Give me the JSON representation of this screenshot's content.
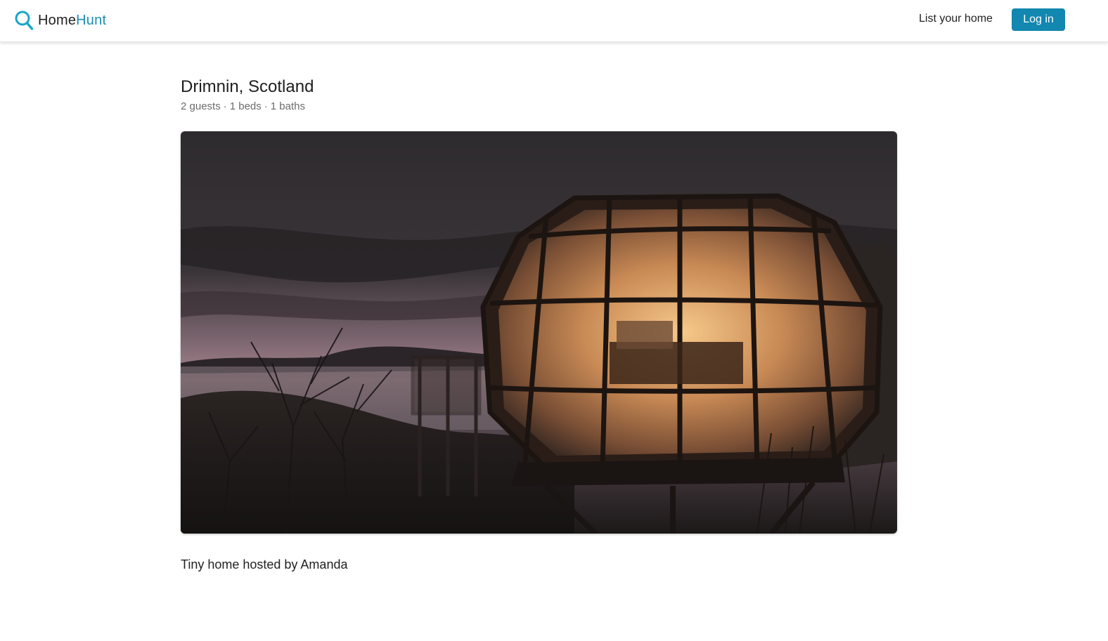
{
  "header": {
    "brand": {
      "part1": "Home",
      "part2": "Hunt",
      "icon": "search-icon"
    },
    "list_home_label": "List your home",
    "login_label": "Log in"
  },
  "listing": {
    "title": "Drimnin, Scotland",
    "guests": "2 guests",
    "beds": "1 beds",
    "baths": "1 baths",
    "separator": "·",
    "photo_subject": "glass-pod-home-at-dusk",
    "host_line": "Tiny home hosted by Amanda"
  },
  "colors": {
    "accent": "#1287b0",
    "brand_accent": "#1a8fb3",
    "text": "#222222",
    "muted": "#6b6b6b"
  }
}
